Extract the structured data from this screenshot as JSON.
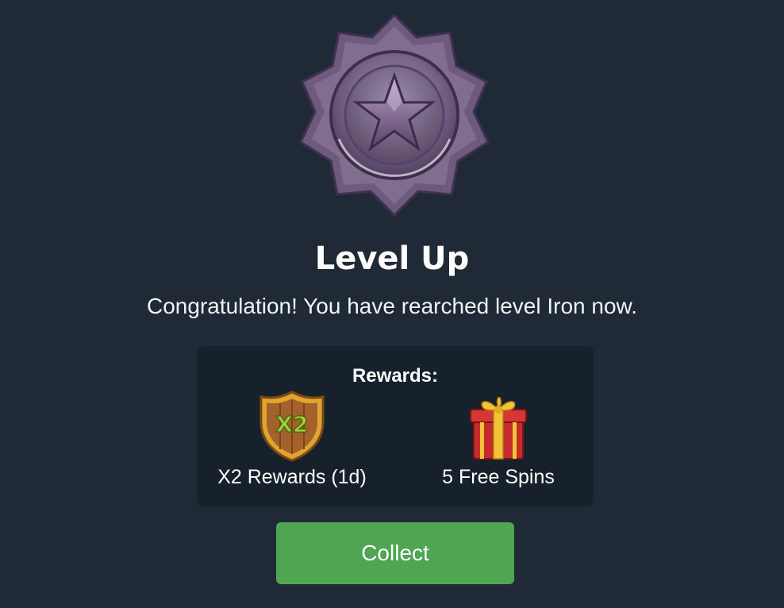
{
  "level_badge": {
    "icon": "star-medal-icon",
    "accent_color": "#8a6fa6"
  },
  "title": "Level Up",
  "message": "Congratulation! You have rearched level Iron now.",
  "rewards": {
    "heading": "Rewards:",
    "items": [
      {
        "icon": "x2-shield-icon",
        "label": "X2 Rewards (1d)"
      },
      {
        "icon": "gift-box-icon",
        "label": "5 Free Spins"
      }
    ]
  },
  "collect_button": {
    "label": "Collect",
    "color": "#4fa552"
  }
}
